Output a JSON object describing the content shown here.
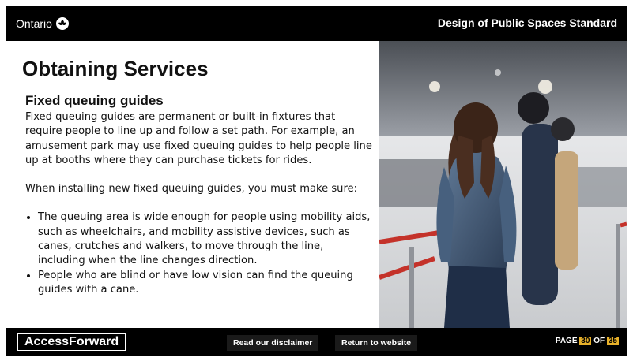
{
  "header": {
    "brand": "Ontario",
    "course_title": "Design of Public Spaces Standard"
  },
  "main": {
    "title": "Obtaining Services",
    "subtitle": "Fixed queuing guides",
    "intro": "Fixed queuing guides are permanent or built-in fixtures that require people to line up and follow a set path. For example, an amusement park may use fixed queuing guides to help people line up at booths where they can purchase tickets for rides.",
    "lead": "When installing new fixed queuing guides, you must make sure:",
    "bullets": [
      "The queuing area is wide enough for people using mobility aids, such as wheelchairs, and mobility assistive devices, such as canes, crutches and walkers, to move through the line, including when the line changes direction.",
      "People who are blind or have low vision can find the queuing guides with a cane."
    ]
  },
  "footer": {
    "logo": "AccessForward",
    "disclaimer_label": "Read our disclaimer",
    "return_label": "Return to website",
    "page_label": "PAGE",
    "page_current": "30",
    "page_of": "OF",
    "page_total": "35"
  },
  "colors": {
    "bar_bg": "#000000",
    "page_badge": "#e8b12a",
    "barrier_red": "#c4322a"
  },
  "icons": {
    "brand": "trillium-icon"
  }
}
